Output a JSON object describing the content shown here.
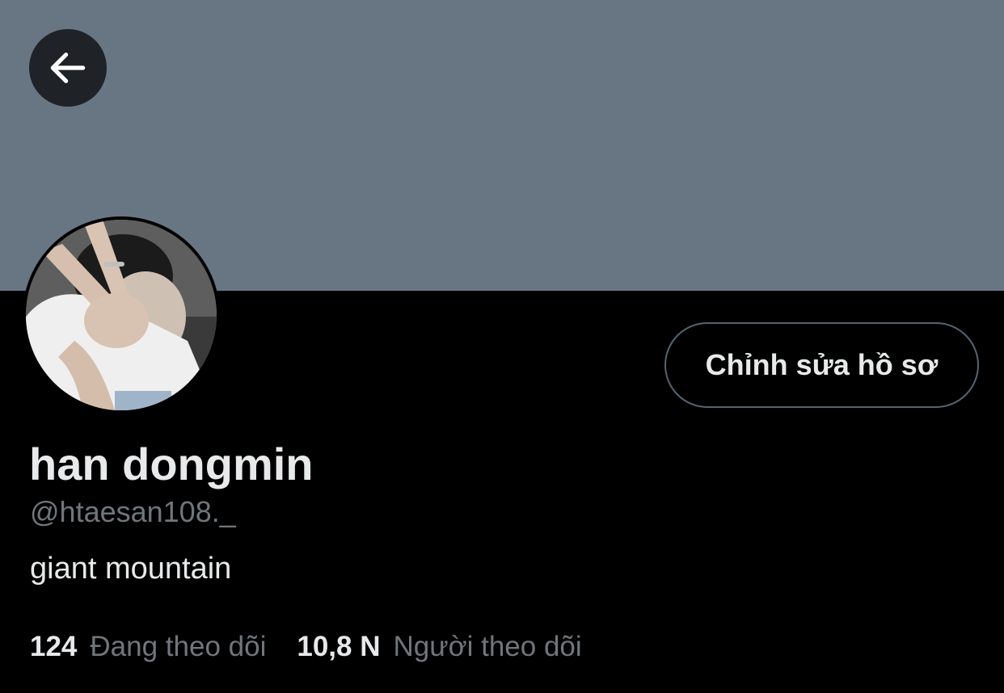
{
  "profile": {
    "display_name": "han dongmin",
    "handle": "@htaesan108._",
    "bio": "giant mountain",
    "edit_button_label": "Chỉnh sửa hồ sơ"
  },
  "stats": {
    "following_count": "124",
    "following_label": "Đang theo dõi",
    "followers_count": "10,8 N",
    "followers_label": "Người theo dõi"
  },
  "icons": {
    "back": "arrow-left-icon"
  },
  "colors": {
    "banner": "#687684",
    "background": "#000000",
    "primary_text": "#e7e9ea",
    "secondary_text": "#71767b",
    "button_border": "#536471"
  }
}
